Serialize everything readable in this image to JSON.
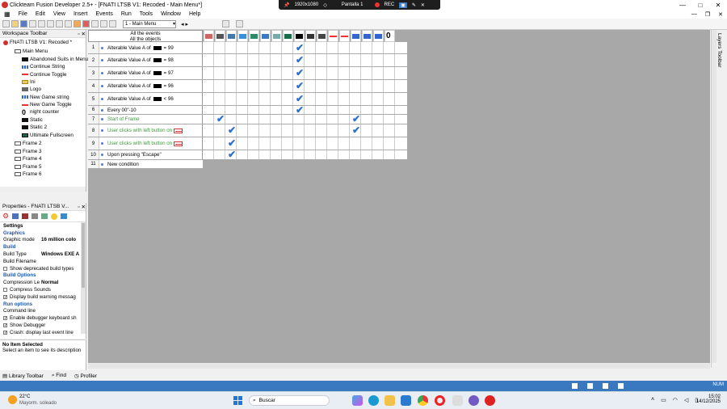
{
  "window": {
    "title": "Clickteam Fusion Developer 2.5+ - [FNATI LTSB V1: Recoded - Main Menu*]",
    "min": "—",
    "max": "□",
    "close": "✕"
  },
  "recorder": {
    "res": "1920x1080",
    "screen": "Pantalla 1",
    "rec": "REC"
  },
  "menu": [
    "File",
    "Edit",
    "View",
    "Insert",
    "Events",
    "Run",
    "Tools",
    "Window",
    "Help"
  ],
  "toolbar": {
    "frame": "1 - Main Menu"
  },
  "workspace": {
    "title": "Workspace Toolbar",
    "app": "FNATI LTSB V1: Recoded *",
    "frame1": "Main Menu",
    "objects": [
      {
        "label": "Abandoned Suits in Menu",
        "icon": "black-box-icon"
      },
      {
        "label": "Continue String",
        "icon": "string-icon"
      },
      {
        "label": "Continue Toggle",
        "icon": "red-line-icon"
      },
      {
        "label": "Ini",
        "icon": "ini-icon"
      },
      {
        "label": "Logo",
        "icon": "logo-icon"
      },
      {
        "label": "New Game string",
        "icon": "string-icon"
      },
      {
        "label": "New Game Toggle",
        "icon": "red-line-icon"
      },
      {
        "label": "night counter",
        "icon": "counter-icon"
      },
      {
        "label": "Static",
        "icon": "black-box-icon"
      },
      {
        "label": "Static 2",
        "icon": "black-box-icon"
      },
      {
        "label": "Ultimate Fullscreen",
        "icon": "green-box-icon"
      }
    ],
    "frames": [
      "Frame 2",
      "Frame 3",
      "Frame 4",
      "Frame 5",
      "Frame 6"
    ]
  },
  "properties": {
    "title": "Properties - FNATI LTSB V...",
    "rows": [
      {
        "type": "head",
        "text": "Settings"
      },
      {
        "type": "sec",
        "text": "Graphics"
      },
      {
        "type": "val",
        "label": "Graphic mode",
        "value": "16 million colo"
      },
      {
        "type": "sec",
        "text": "Build"
      },
      {
        "type": "val",
        "label": "Build Type",
        "value": "Windows EXE A"
      },
      {
        "type": "val",
        "label": "Build Filename",
        "value": ""
      },
      {
        "type": "chk",
        "label": "Show deprecated build types",
        "checked": false
      },
      {
        "type": "sec",
        "text": "Build Options"
      },
      {
        "type": "val",
        "label": "Compression Le",
        "value": "Normal"
      },
      {
        "type": "chk",
        "label": "Compress Sounds",
        "checked": false
      },
      {
        "type": "chk",
        "label": "Display build warning messag",
        "checked": true
      },
      {
        "type": "sec",
        "text": "Run options"
      },
      {
        "type": "val",
        "label": "Command line",
        "value": ""
      },
      {
        "type": "chk",
        "label": "Enable debugger keyboard sh",
        "checked": true
      },
      {
        "type": "chk",
        "label": "Show Debugger",
        "checked": true
      },
      {
        "type": "chk",
        "label": "Crash: display last event line",
        "checked": true
      }
    ]
  },
  "description": {
    "title": "No Item Selected",
    "text": "Select an item to see its description"
  },
  "bottom_tabs": [
    "Library Toolbar",
    "Find",
    "Profiler"
  ],
  "status": {
    "num": "NUM"
  },
  "events_header": {
    "line1": "All the events",
    "line2": "All the objects"
  },
  "events": [
    {
      "n": "1",
      "text": "Alterable Value A of",
      "suffix": "= 99",
      "sw": "black",
      "green": false
    },
    {
      "n": "2",
      "text": "Alterable Value A of",
      "suffix": "= 98",
      "sw": "black",
      "green": false
    },
    {
      "n": "3",
      "text": "Alterable Value A of",
      "suffix": "= 97",
      "sw": "black",
      "green": false
    },
    {
      "n": "4",
      "text": "Alterable Value A of",
      "suffix": "= 96",
      "sw": "black",
      "green": false
    },
    {
      "n": "5",
      "text": "Alterable Value A of",
      "suffix": "< 96",
      "sw": "black",
      "green": false
    },
    {
      "n": "6",
      "text": "Every 00\"-10",
      "suffix": "",
      "sw": "",
      "green": false
    },
    {
      "n": "7",
      "text": "Start of Frame",
      "suffix": "",
      "sw": "",
      "green": true
    },
    {
      "n": "8",
      "text": "User clicks with left button on",
      "suffix": "",
      "sw": "red",
      "green": true
    },
    {
      "n": "9",
      "text": "User clicks with left button on",
      "suffix": "",
      "sw": "red",
      "green": true
    },
    {
      "n": "10",
      "text": "Upon pressing \"Escape\"",
      "suffix": "",
      "sw": "",
      "green": false
    },
    {
      "n": "11",
      "text": "New condition",
      "suffix": "",
      "sw": "",
      "green": false
    }
  ],
  "layers": "Layers Toolbar",
  "taskbar": {
    "temp": "22°C",
    "weather": "Mayorm. soleado",
    "search": "Buscar",
    "time": "15:02",
    "date": "14/12/2025"
  }
}
